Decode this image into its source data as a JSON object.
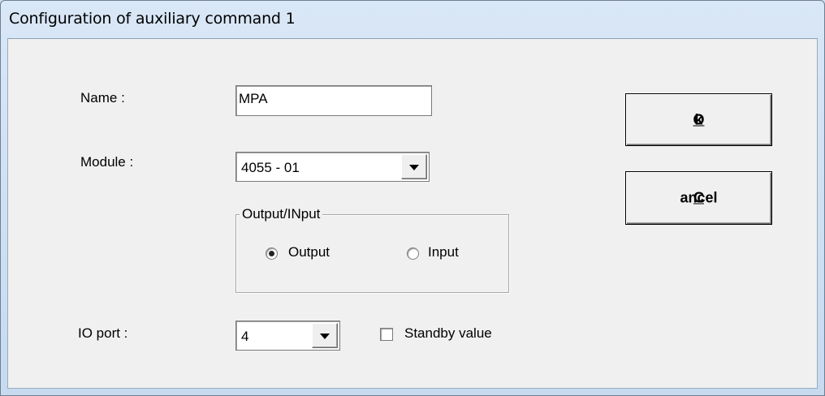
{
  "window": {
    "title": "Configuration of auxiliary command 1"
  },
  "form": {
    "name_label": "Name :",
    "name_value": "MPA",
    "module_label": "Module :",
    "module_value": "4055 - 01",
    "group_title": "Output/INput",
    "radio_output": "Output",
    "radio_input": "Input",
    "selected_direction": "Output",
    "io_port_label": "IO port :",
    "io_port_value": "4",
    "standby_label": "Standby value",
    "standby_checked": false
  },
  "buttons": {
    "ok_mnemonic": "O",
    "ok_rest": "k",
    "cancel_mnemonic": "C",
    "cancel_rest": "ancel"
  }
}
